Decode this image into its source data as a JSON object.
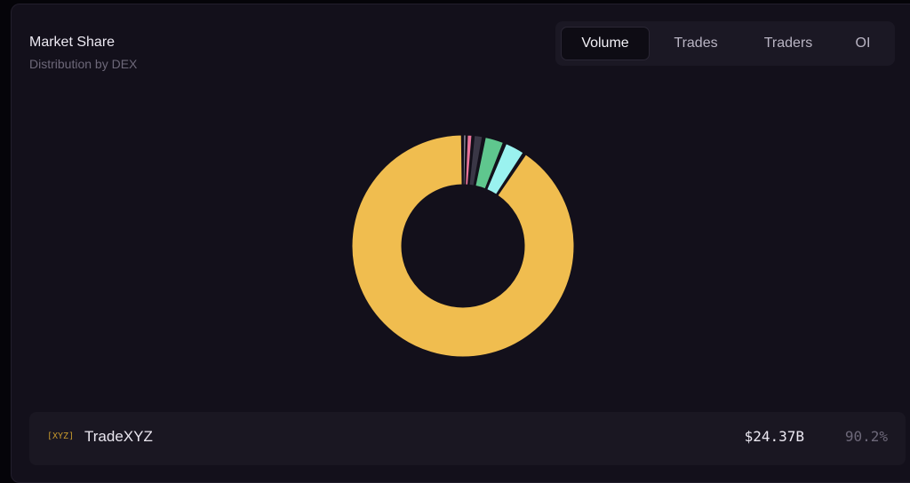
{
  "card": {
    "title": "Market Share",
    "subtitle": "Distribution by DEX"
  },
  "tabs": [
    {
      "label": "Volume",
      "active": true
    },
    {
      "label": "Trades",
      "active": false
    },
    {
      "label": "Traders",
      "active": false
    },
    {
      "label": "OI",
      "active": false
    }
  ],
  "chart_data": {
    "type": "pie",
    "variant": "donut",
    "title": "",
    "slices": [
      {
        "name": "TradeXYZ",
        "value": 90.2,
        "color": "#f0bd4f"
      },
      {
        "name": "",
        "value": 3.2,
        "color": "#9af2ef"
      },
      {
        "name": "",
        "value": 3.1,
        "color": "#5fc78e"
      },
      {
        "name": "",
        "value": 1.6,
        "color": "#3a3746"
      },
      {
        "name": "",
        "value": 0.9,
        "color": "#e8749a"
      },
      {
        "name": "",
        "value": 0.5,
        "color": "#7e7a8a"
      }
    ],
    "legend": "list-below"
  },
  "list": [
    {
      "tag": "[XYZ]",
      "name": "TradeXYZ",
      "value": "$24.37B",
      "percent": "90.2%"
    }
  ]
}
